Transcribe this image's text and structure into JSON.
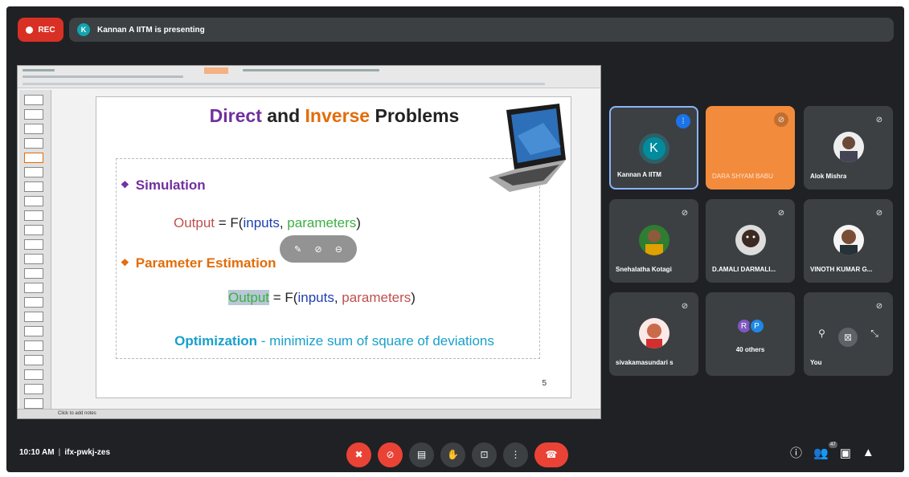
{
  "meeting": {
    "rec_label": "REC",
    "presenter_initial": "K",
    "presenting_text": "Kannan A IITM is presenting",
    "time": "10:10 AM",
    "separator": "|",
    "code": "ifx-pwkj-zes"
  },
  "slide": {
    "title_part1": "Direct",
    "title_part2": " and ",
    "title_part3": "Inverse",
    "title_part4": " Problems",
    "bullet1": "Simulation",
    "eq1": {
      "output": "Output",
      "eq": " = F(",
      "inputs": "inputs",
      "comma": ", ",
      "params": "parameters",
      "close": ")"
    },
    "bullet2": "Parameter Estimation",
    "eq2": {
      "output": "Output",
      "eq": " = F(",
      "inputs": "inputs",
      "comma": ", ",
      "params": "parameters",
      "close": ")"
    },
    "optim_bold": "Optimization",
    "optim_rest": " - minimize sum of square of deviations",
    "page_number": "5",
    "notes_placeholder": "Click to add notes"
  },
  "participants": [
    {
      "name": "Kannan A IITM",
      "initial": "K",
      "speaking": true
    },
    {
      "name": "DARA SHYAM BABU"
    },
    {
      "name": "Alok Mishra"
    },
    {
      "name": "Snehalatha Kotagi"
    },
    {
      "name": "D.AMALI DARMALI..."
    },
    {
      "name": "VINOTH KUMAR G..."
    },
    {
      "name": "sivakamasundari s"
    },
    {
      "name": "40 others",
      "initials": [
        "R",
        "P"
      ]
    },
    {
      "name": "You"
    }
  ],
  "people_count": "47",
  "colors": {
    "background": "#202124",
    "tile": "#3c4043",
    "red": "#ea4335",
    "orange_tile": "#f28b3c",
    "accent_blue": "#8ab4f8"
  },
  "icons": [
    "mic-off-icon",
    "camera-off-icon",
    "captions-icon",
    "raise-hand-icon",
    "present-icon",
    "more-icon",
    "hangup-icon",
    "info-icon",
    "people-icon",
    "chat-icon",
    "activities-icon"
  ]
}
